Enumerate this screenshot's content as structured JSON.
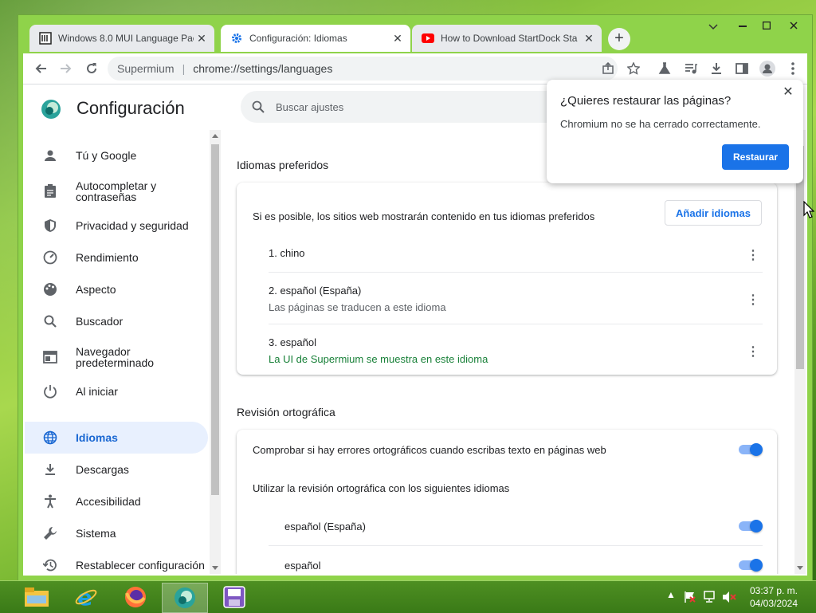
{
  "tabs": [
    {
      "title": "Windows 8.0 MUI Language Pac",
      "icon": "page-icon",
      "active": false
    },
    {
      "title": "Configuración: Idiomas",
      "icon": "gear-icon",
      "active": true
    },
    {
      "title": "How to Download StartDock Sta",
      "icon": "youtube-icon",
      "active": false
    }
  ],
  "omnibox": {
    "site": "Supermium",
    "separator": "|",
    "url": "chrome://settings/languages"
  },
  "settings": {
    "title": "Configuración",
    "search_placeholder": "Buscar ajustes",
    "nav": [
      {
        "label": "Tú y Google",
        "icon": "person-icon"
      },
      {
        "label": "Autocompletar y contraseñas",
        "icon": "clipboard-icon"
      },
      {
        "label": "Privacidad y seguridad",
        "icon": "shield-icon"
      },
      {
        "label": "Rendimiento",
        "icon": "speedometer-icon"
      },
      {
        "label": "Aspecto",
        "icon": "palette-icon"
      },
      {
        "label": "Buscador",
        "icon": "search-icon"
      },
      {
        "label": "Navegador predeterminado",
        "icon": "browser-icon"
      },
      {
        "label": "Al iniciar",
        "icon": "power-icon"
      },
      {
        "label": "Idiomas",
        "icon": "globe-icon",
        "selected": true
      },
      {
        "label": "Descargas",
        "icon": "download-icon"
      },
      {
        "label": "Accesibilidad",
        "icon": "accessibility-icon"
      },
      {
        "label": "Sistema",
        "icon": "wrench-icon"
      },
      {
        "label": "Restablecer configuración",
        "icon": "restore-icon"
      }
    ],
    "preferred": {
      "title": "Idiomas preferidos",
      "description": "Si es posible, los sitios web mostrarán contenido en tus idiomas preferidos",
      "add_button": "Añadir idiomas",
      "languages": [
        {
          "name": "1. chino",
          "note": ""
        },
        {
          "name": "2. español (España)",
          "note": "Las páginas se traducen a este idioma"
        },
        {
          "name": "3. español",
          "note": "La UI de Supermium se muestra en este idioma"
        }
      ]
    },
    "spellcheck": {
      "title": "Revisión ortográfica",
      "check_label": "Comprobar si hay errores ortográficos cuando escribas texto en páginas web",
      "use_label": "Utilizar la revisión ortográfica con los siguientes idiomas",
      "languages": [
        {
          "name": "español (España)",
          "enabled": true
        },
        {
          "name": "español",
          "enabled": true
        }
      ]
    }
  },
  "popup": {
    "title": "¿Quieres restaurar las páginas?",
    "message": "Chromium no se ha cerrado correctamente.",
    "button": "Restaurar"
  },
  "taskbar": {
    "apps": [
      "file-explorer-icon",
      "internet-explorer-icon",
      "firefox-icon",
      "supermium-icon",
      "floppy-icon"
    ],
    "time": "03:37 p. m.",
    "date": "04/03/2024"
  },
  "colors": {
    "accent": "#1a73e8",
    "selected_bg": "#e8f0fe",
    "green_note": "#188038",
    "window_frame": "#8fd34a"
  }
}
